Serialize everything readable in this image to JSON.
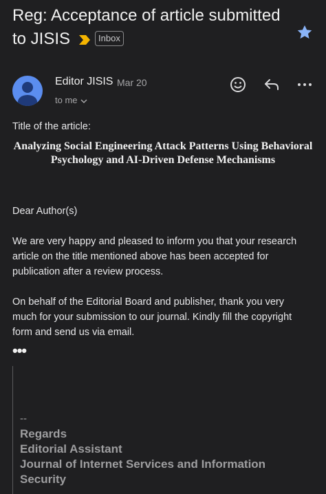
{
  "email": {
    "subject": "Reg: Acceptance of article submitted to JISIS",
    "label": "Inbox",
    "sender": "Editor JISIS",
    "date": "Mar 20",
    "recipient": "to me"
  },
  "icons": {
    "importance": "importance-marker-icon",
    "star": "star-icon",
    "avatar": "person-avatar-icon",
    "emoji": "emoji-react-icon",
    "reply": "reply-icon",
    "more": "more-options-icon",
    "chevron": "chevron-down-icon"
  },
  "colors": {
    "background": "#1f1f21",
    "star": "#8ab4f8",
    "importance": "#f4b400",
    "avatar": "#5b8def"
  },
  "body": {
    "title_label": "Title of the article:",
    "article_title": "Analyzing Social Engineering Attack Patterns Using Behavioral Psychology and AI-Driven Defense Mechanisms",
    "greeting": "Dear Author(s)",
    "paragraph1": "We are very happy and pleased to inform you that your research article on the title mentioned above has been accepted for publication after a review process.",
    "paragraph2": "On behalf of the Editorial Board and publisher, thank you very much for your submission to our journal. Kindly fill the copyright form and send us via email.",
    "ellipsis": "•••"
  },
  "signature": {
    "separator": "--",
    "line1": "Regards",
    "line2": "Editorial Assistant",
    "line3": "Journal of Internet Services and Information Security"
  }
}
